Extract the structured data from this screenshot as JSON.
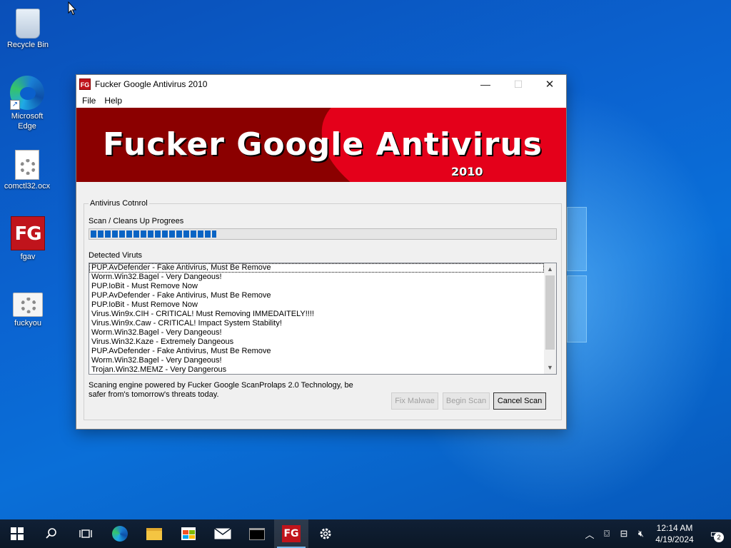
{
  "desktop": {
    "icons": [
      {
        "label": "Recycle Bin",
        "icon": "recycle-bin-icon"
      },
      {
        "label": "Microsoft Edge",
        "icon": "edge-icon"
      },
      {
        "label": "comctl32.ocx",
        "icon": "settings-file-icon"
      },
      {
        "label": "fgav",
        "icon": "fg-app-icon"
      },
      {
        "label": "fuckyou",
        "icon": "settings-file-icon"
      }
    ]
  },
  "window": {
    "title": "Fucker Google Antivirus 2010",
    "app_icon_text": "FG",
    "controls": {
      "minimize": "—",
      "maximize": "☐",
      "close": "✕"
    },
    "menu": [
      "File",
      "Help"
    ],
    "banner": {
      "name": "Fucker Google Antivirus",
      "year": "2010",
      "colors": {
        "dark": "#8b0000",
        "bright": "#e4001a"
      }
    },
    "group_title": "Antivirus Cotnrol",
    "progress_label": "Scan / Cleans Up Progrees",
    "progress_value": 0.27,
    "detected_label": "Detected Viruts",
    "detected": [
      "PUP.AvDefender - Fake Antivirus, Must Be Remove",
      "Worm.Win32.Bagel - Very Dangeous!",
      "PUP.IoBit - Must Remove Now",
      "PUP.AvDefender - Fake Antivirus, Must Be Remove",
      "PUP.IoBit - Must Remove Now",
      "Virus.Win9x.CIH - CRITICAL! Must Removing IMMEDAITELY!!!!",
      "Virus.Win9x.Caw - CRITICAL! Impact System Stability!",
      "Worm.Win32.Bagel - Very Dangeous!",
      "Virus.Win32.Kaze  - Extremely Dangeous",
      "PUP.AvDefender - Fake Antivirus, Must Be Remove",
      "Worm.Win32.Bagel - Very Dangeous!",
      "Trojan.Win32.MEMZ - Very Dangerous"
    ],
    "engine_text": "Scaning engine powered by Fucker Google ScanProlaps 2.0 Technology, be safer from's tomorrow's threats today.",
    "buttons": {
      "fix": "Fix Malwae",
      "begin": "Begin Scan",
      "cancel": "Cancel Scan"
    },
    "progress_color": "#0a64c4"
  },
  "taskbar": {
    "apps": [
      "start-icon",
      "search-icon",
      "task-view-icon",
      "edge-icon",
      "file-explorer-icon",
      "store-icon",
      "mail-icon",
      "terminal-icon",
      "fg-app-icon",
      "settings-icon"
    ],
    "fg_icon_text": "FG",
    "time": "12:14 AM",
    "date": "4/19/2024",
    "notification_count": "2"
  }
}
